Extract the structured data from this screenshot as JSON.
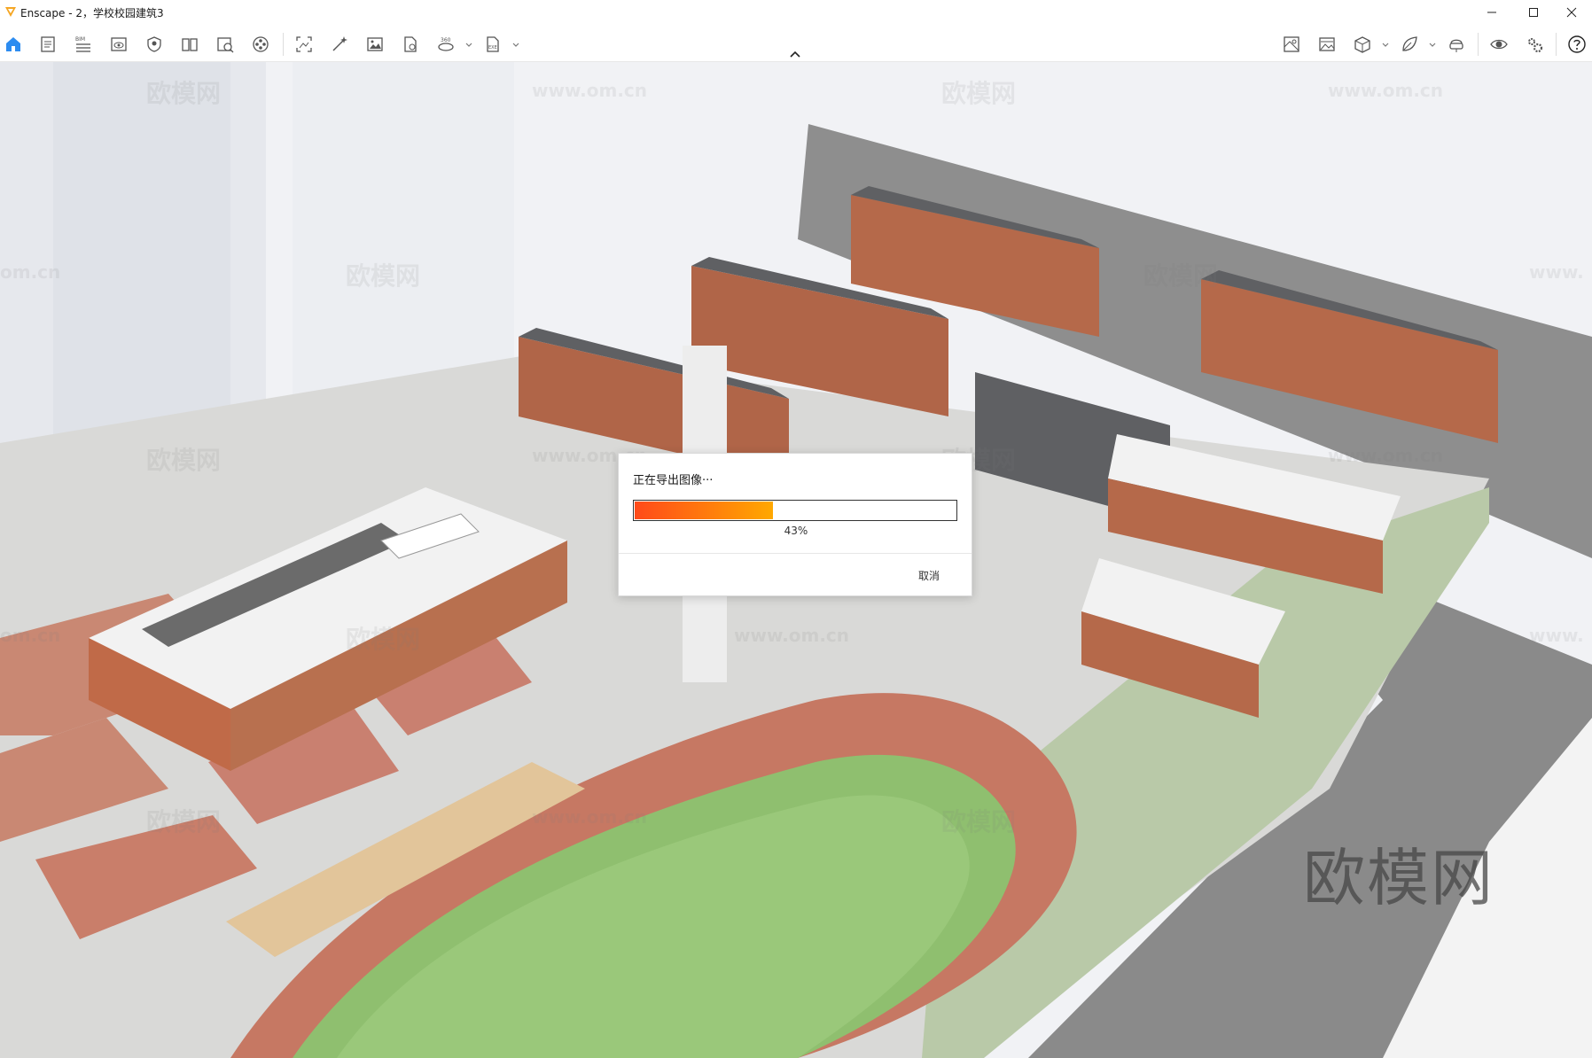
{
  "window": {
    "title": "Enscape - 2，学校校园建筑3",
    "logo_icon": "enscape-logo-icon",
    "controls": [
      "minimize-icon",
      "maximize-icon",
      "close-icon"
    ]
  },
  "toolbar": {
    "left_tools": [
      {
        "name": "home",
        "icon": "home-icon",
        "active": true
      },
      {
        "name": "file-settings",
        "icon": "document-icon"
      },
      {
        "name": "bim",
        "icon": "bim-list-icon",
        "badge": "BIM"
      },
      {
        "name": "views",
        "icon": "eye-window-icon"
      },
      {
        "name": "assets",
        "icon": "shield-icon"
      },
      {
        "name": "materials",
        "icon": "book-icon"
      },
      {
        "name": "collaboration",
        "icon": "capture-icon"
      },
      {
        "name": "video",
        "icon": "film-reel-icon"
      },
      {
        "name": "screenshot",
        "icon": "screenshot-icon"
      },
      {
        "name": "batch",
        "icon": "magic-wand-icon"
      },
      {
        "name": "image-export",
        "icon": "image-icon"
      },
      {
        "name": "web-export",
        "icon": "file-export-icon"
      },
      {
        "name": "panorama",
        "icon": "panorama-360-icon",
        "badge": "360"
      },
      {
        "name": "exe-export",
        "icon": "exe-file-icon",
        "badge": "EXE"
      }
    ],
    "right_tools": [
      {
        "name": "site-context",
        "icon": "map-icon"
      },
      {
        "name": "atmosphere",
        "icon": "landscape-icon"
      },
      {
        "name": "cube",
        "icon": "cube-icon"
      },
      {
        "name": "render-mode",
        "icon": "leaf-icon"
      },
      {
        "name": "vr",
        "icon": "vr-headset-icon"
      },
      {
        "name": "visual-settings",
        "icon": "eye-icon"
      },
      {
        "name": "settings",
        "icon": "gears-icon"
      },
      {
        "name": "help",
        "icon": "help-icon"
      }
    ],
    "collapse_icon": "chevron-up-icon"
  },
  "viewport": {
    "watermarks": [
      "欧模网",
      "www.om.cn",
      "欧模网",
      "www.om.cn",
      "om.cn",
      "欧模网",
      "欧模网",
      "www.",
      "欧模网",
      "www.om.cn",
      "欧模网",
      "www.om.cn",
      "om.cn",
      "欧模网",
      "www.om.cn",
      "www.",
      "欧模网",
      "www.om.cn",
      "欧模网"
    ],
    "brand_watermark": "欧模网"
  },
  "dialog": {
    "title": "正在导出图像···",
    "progress": 43,
    "progress_label": "43%",
    "cancel_label": "取消",
    "colors": {
      "fill_start": "#ff4a1a",
      "fill_end": "#ffa800"
    }
  }
}
